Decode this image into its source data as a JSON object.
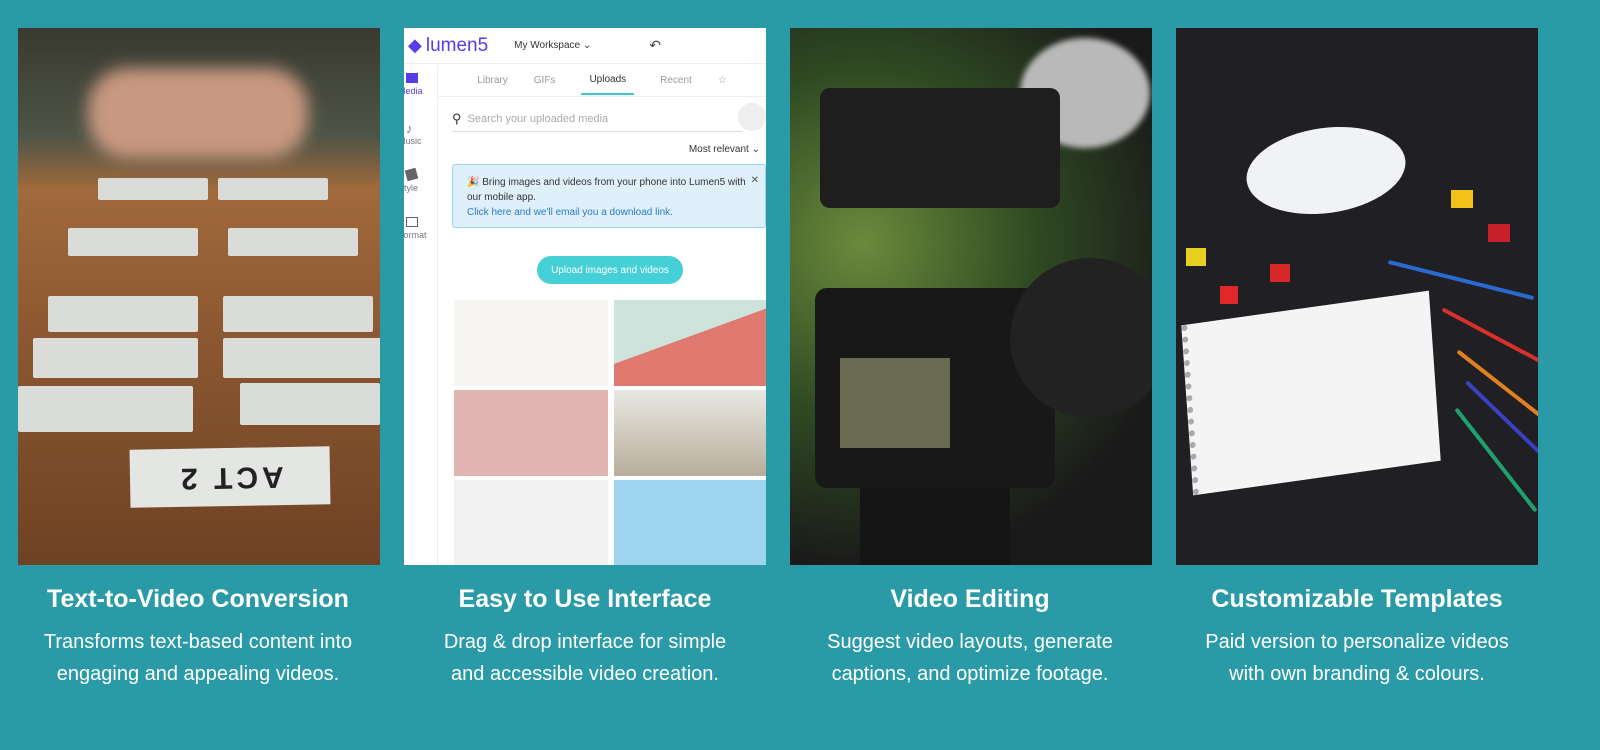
{
  "features": [
    {
      "title": "Text-to-Video Conversion",
      "desc_lines": [
        "Transforms text-based content into",
        "engaging and appealing videos."
      ],
      "image": {
        "card_text": "ACT 2"
      }
    },
    {
      "title": "Easy to Use Interface",
      "desc_lines": [
        "Drag & drop interface for simple",
        "and accessible video creation."
      ]
    },
    {
      "title": "Video Editing",
      "desc_lines": [
        "Suggest video layouts, generate",
        "captions, and optimize footage."
      ]
    },
    {
      "title": "Customizable Templates",
      "desc_lines": [
        "Paid version to personalize videos",
        "with own branding & colours."
      ]
    }
  ],
  "lumen5": {
    "logo": "lumen5",
    "workspace": "My Workspace ⌄",
    "undo_icon": "↶",
    "sidebar": [
      "Media",
      "Music",
      "Style",
      "Format"
    ],
    "tabs": [
      "Library",
      "GIFs",
      "Uploads",
      "Recent",
      "☆"
    ],
    "search_placeholder": "Search your uploaded media",
    "sort": "Most relevant ⌄",
    "banner_text": "🎉 Bring images and videos from your phone into Lumen5 with our mobile app.",
    "banner_link": "Click here and we'll email you a download link.",
    "close": "✕",
    "upload_button": "Upload images and videos"
  },
  "colors": {
    "background": "#2a9ba6",
    "brand": "#5b3be6",
    "accent": "#45cfd6"
  }
}
